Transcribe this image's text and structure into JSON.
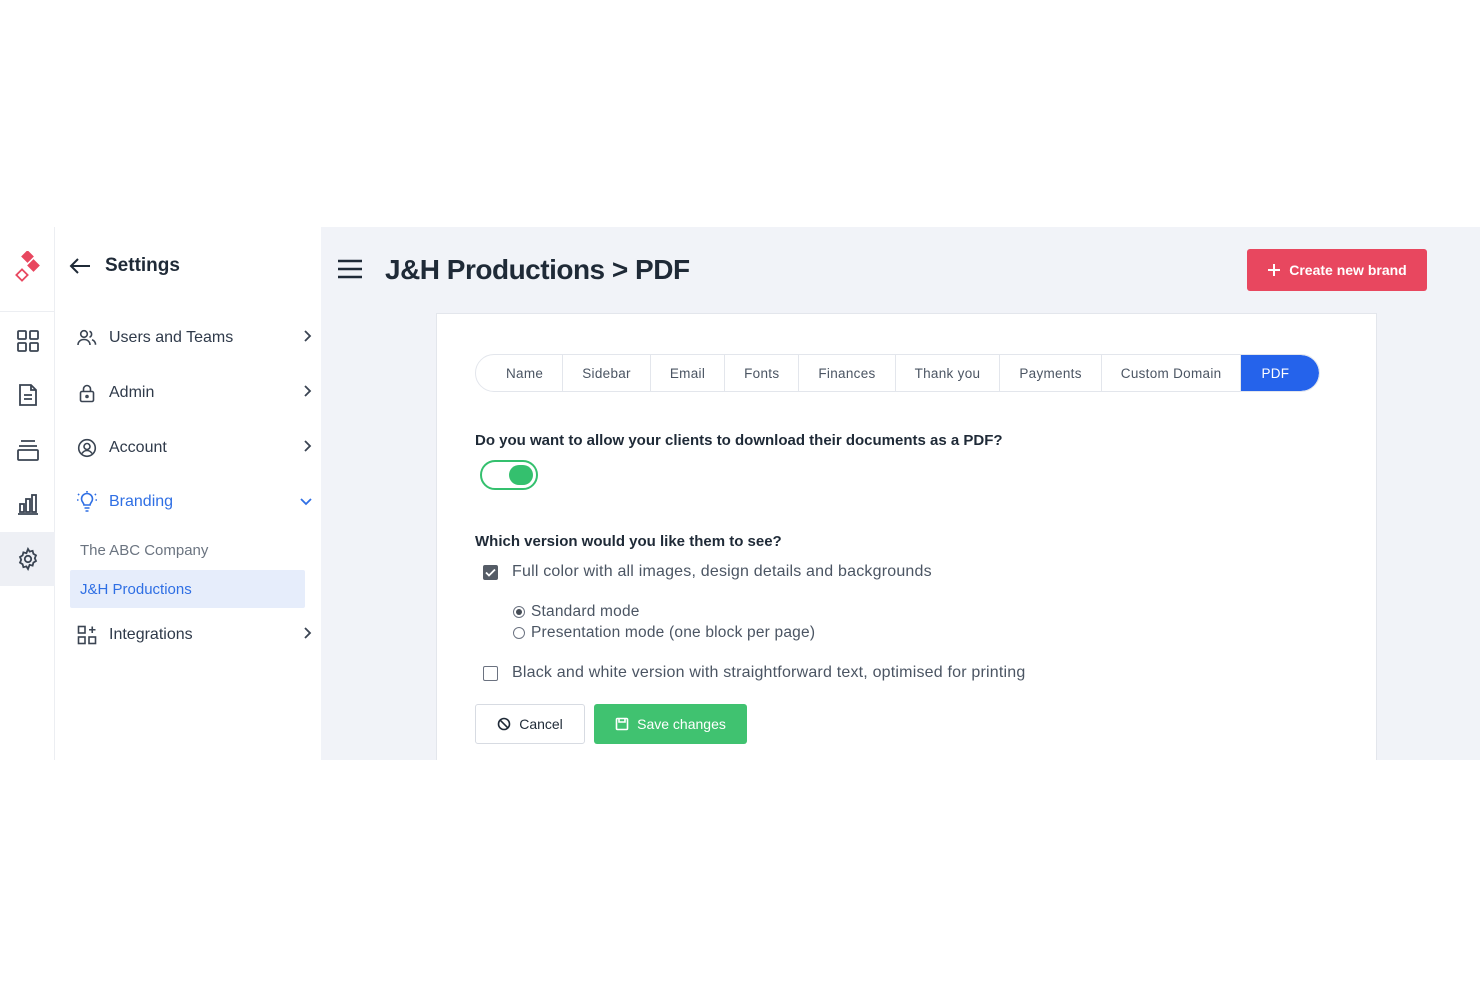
{
  "settings": {
    "back_icon": "arrow-left-icon",
    "title": "Settings",
    "nav": [
      {
        "label": "Users and Teams",
        "icon": "users-icon"
      },
      {
        "label": "Admin",
        "icon": "lock-icon"
      },
      {
        "label": "Account",
        "icon": "user-circle-icon"
      },
      {
        "label": "Branding",
        "icon": "lightbulb-icon",
        "expanded": true
      },
      {
        "label": "Integrations",
        "icon": "apps-add-icon"
      }
    ],
    "branding_items": [
      "The ABC Company",
      "J&H Productions"
    ]
  },
  "rail_icons": [
    "dashboard-icon",
    "document-icon",
    "stack-icon",
    "bar-chart-icon",
    "gear-icon"
  ],
  "header": {
    "title": "J&H Productions > PDF",
    "create_label": "Create new brand"
  },
  "tabs": [
    "Name",
    "Sidebar",
    "Email",
    "Fonts",
    "Finances",
    "Thank you",
    "Payments",
    "Custom Domain",
    "PDF"
  ],
  "active_tab": "PDF",
  "form": {
    "download_question": "Do you want to allow your clients to download their documents as a PDF?",
    "download_enabled": true,
    "version_question": "Which version would you like them to see?",
    "full_color_label": "Full color with all images, design details and backgrounds",
    "full_color_checked": true,
    "standard_mode_label": "Standard mode",
    "presentation_mode_label": "Presentation mode (one block per page)",
    "selected_mode": "Standard mode",
    "bw_label": "Black and white version with straightforward text, optimised for printing",
    "bw_checked": false,
    "cancel_label": "Cancel",
    "save_label": "Save changes"
  },
  "colors": {
    "accent_blue": "#2563eb",
    "brand_red": "#e8475f",
    "success_green": "#40c270"
  }
}
